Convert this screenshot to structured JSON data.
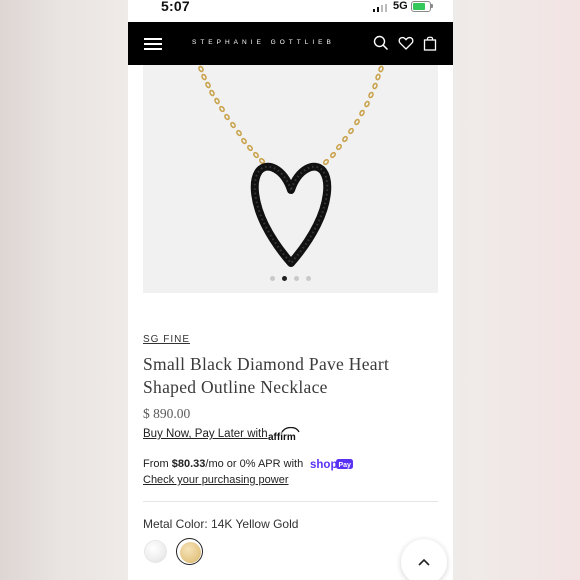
{
  "status_bar": {
    "time": "5:07",
    "network": "5G"
  },
  "header": {
    "brand": "STEPHANIE GOTTLIEB",
    "icons": [
      "menu-icon",
      "search-icon",
      "heart-icon",
      "bag-icon"
    ],
    "background": "#000000"
  },
  "gallery": {
    "image_count": 4,
    "active_index": 1,
    "image": "black diamond heart outline necklace on gold chain"
  },
  "product": {
    "brand_link": "SG FINE",
    "title": "Small Black Diamond Pave Heart Shaped Outline Necklace",
    "price": "$ 890.00",
    "affirm_text": "Buy Now, Pay Later with",
    "affirm_logo": "affirm",
    "installment_prefix": "From ",
    "installment_amount": "$80.33",
    "installment_suffix": "/mo or 0% APR with",
    "shop_pay_logo": "shop",
    "shop_pay_badge": "Pay",
    "check_power": "Check your purchasing power",
    "metal_label": "Metal Color: 14K Yellow Gold",
    "swatches": [
      {
        "name": "White Gold",
        "color": "#eeeeee",
        "selected": false
      },
      {
        "name": "14K Yellow Gold",
        "color": "#e6c98a",
        "selected": true
      }
    ]
  },
  "colors": {
    "shop_pay": "#5a31f4",
    "affirm": "#0fa0ea"
  }
}
